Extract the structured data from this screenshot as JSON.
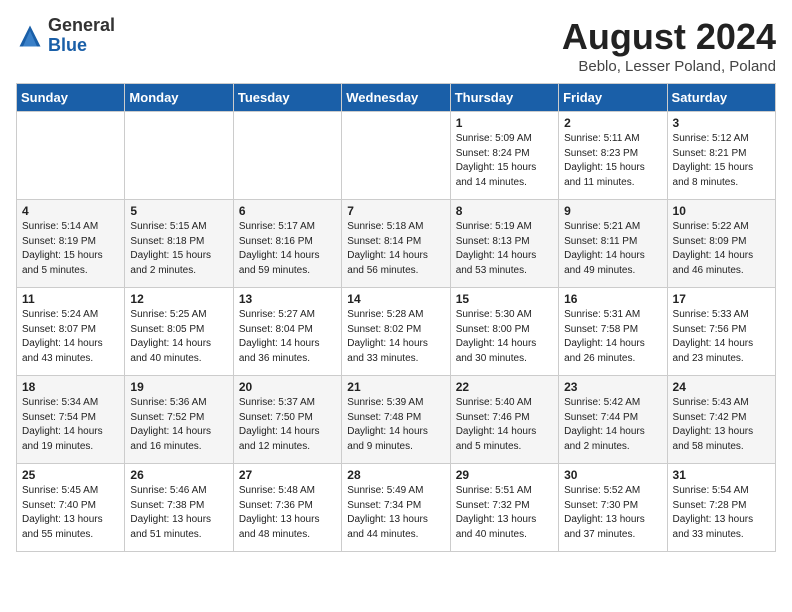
{
  "header": {
    "logo_general": "General",
    "logo_blue": "Blue",
    "title": "August 2024",
    "subtitle": "Beblo, Lesser Poland, Poland"
  },
  "days_of_week": [
    "Sunday",
    "Monday",
    "Tuesday",
    "Wednesday",
    "Thursday",
    "Friday",
    "Saturday"
  ],
  "weeks": [
    [
      {
        "day": "",
        "info": ""
      },
      {
        "day": "",
        "info": ""
      },
      {
        "day": "",
        "info": ""
      },
      {
        "day": "",
        "info": ""
      },
      {
        "day": "1",
        "info": "Sunrise: 5:09 AM\nSunset: 8:24 PM\nDaylight: 15 hours\nand 14 minutes."
      },
      {
        "day": "2",
        "info": "Sunrise: 5:11 AM\nSunset: 8:23 PM\nDaylight: 15 hours\nand 11 minutes."
      },
      {
        "day": "3",
        "info": "Sunrise: 5:12 AM\nSunset: 8:21 PM\nDaylight: 15 hours\nand 8 minutes."
      }
    ],
    [
      {
        "day": "4",
        "info": "Sunrise: 5:14 AM\nSunset: 8:19 PM\nDaylight: 15 hours\nand 5 minutes."
      },
      {
        "day": "5",
        "info": "Sunrise: 5:15 AM\nSunset: 8:18 PM\nDaylight: 15 hours\nand 2 minutes."
      },
      {
        "day": "6",
        "info": "Sunrise: 5:17 AM\nSunset: 8:16 PM\nDaylight: 14 hours\nand 59 minutes."
      },
      {
        "day": "7",
        "info": "Sunrise: 5:18 AM\nSunset: 8:14 PM\nDaylight: 14 hours\nand 56 minutes."
      },
      {
        "day": "8",
        "info": "Sunrise: 5:19 AM\nSunset: 8:13 PM\nDaylight: 14 hours\nand 53 minutes."
      },
      {
        "day": "9",
        "info": "Sunrise: 5:21 AM\nSunset: 8:11 PM\nDaylight: 14 hours\nand 49 minutes."
      },
      {
        "day": "10",
        "info": "Sunrise: 5:22 AM\nSunset: 8:09 PM\nDaylight: 14 hours\nand 46 minutes."
      }
    ],
    [
      {
        "day": "11",
        "info": "Sunrise: 5:24 AM\nSunset: 8:07 PM\nDaylight: 14 hours\nand 43 minutes."
      },
      {
        "day": "12",
        "info": "Sunrise: 5:25 AM\nSunset: 8:05 PM\nDaylight: 14 hours\nand 40 minutes."
      },
      {
        "day": "13",
        "info": "Sunrise: 5:27 AM\nSunset: 8:04 PM\nDaylight: 14 hours\nand 36 minutes."
      },
      {
        "day": "14",
        "info": "Sunrise: 5:28 AM\nSunset: 8:02 PM\nDaylight: 14 hours\nand 33 minutes."
      },
      {
        "day": "15",
        "info": "Sunrise: 5:30 AM\nSunset: 8:00 PM\nDaylight: 14 hours\nand 30 minutes."
      },
      {
        "day": "16",
        "info": "Sunrise: 5:31 AM\nSunset: 7:58 PM\nDaylight: 14 hours\nand 26 minutes."
      },
      {
        "day": "17",
        "info": "Sunrise: 5:33 AM\nSunset: 7:56 PM\nDaylight: 14 hours\nand 23 minutes."
      }
    ],
    [
      {
        "day": "18",
        "info": "Sunrise: 5:34 AM\nSunset: 7:54 PM\nDaylight: 14 hours\nand 19 minutes."
      },
      {
        "day": "19",
        "info": "Sunrise: 5:36 AM\nSunset: 7:52 PM\nDaylight: 14 hours\nand 16 minutes."
      },
      {
        "day": "20",
        "info": "Sunrise: 5:37 AM\nSunset: 7:50 PM\nDaylight: 14 hours\nand 12 minutes."
      },
      {
        "day": "21",
        "info": "Sunrise: 5:39 AM\nSunset: 7:48 PM\nDaylight: 14 hours\nand 9 minutes."
      },
      {
        "day": "22",
        "info": "Sunrise: 5:40 AM\nSunset: 7:46 PM\nDaylight: 14 hours\nand 5 minutes."
      },
      {
        "day": "23",
        "info": "Sunrise: 5:42 AM\nSunset: 7:44 PM\nDaylight: 14 hours\nand 2 minutes."
      },
      {
        "day": "24",
        "info": "Sunrise: 5:43 AM\nSunset: 7:42 PM\nDaylight: 13 hours\nand 58 minutes."
      }
    ],
    [
      {
        "day": "25",
        "info": "Sunrise: 5:45 AM\nSunset: 7:40 PM\nDaylight: 13 hours\nand 55 minutes."
      },
      {
        "day": "26",
        "info": "Sunrise: 5:46 AM\nSunset: 7:38 PM\nDaylight: 13 hours\nand 51 minutes."
      },
      {
        "day": "27",
        "info": "Sunrise: 5:48 AM\nSunset: 7:36 PM\nDaylight: 13 hours\nand 48 minutes."
      },
      {
        "day": "28",
        "info": "Sunrise: 5:49 AM\nSunset: 7:34 PM\nDaylight: 13 hours\nand 44 minutes."
      },
      {
        "day": "29",
        "info": "Sunrise: 5:51 AM\nSunset: 7:32 PM\nDaylight: 13 hours\nand 40 minutes."
      },
      {
        "day": "30",
        "info": "Sunrise: 5:52 AM\nSunset: 7:30 PM\nDaylight: 13 hours\nand 37 minutes."
      },
      {
        "day": "31",
        "info": "Sunrise: 5:54 AM\nSunset: 7:28 PM\nDaylight: 13 hours\nand 33 minutes."
      }
    ]
  ]
}
